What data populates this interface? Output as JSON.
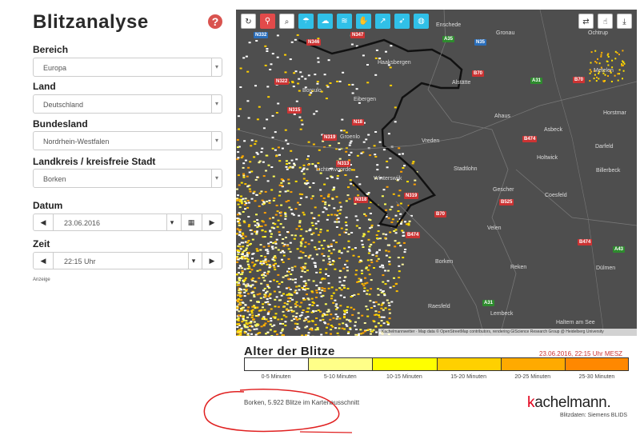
{
  "page_title": "Blitzanalyse",
  "help_icon": "?",
  "filters": {
    "bereich_label": "Bereich",
    "bereich_value": "Europa",
    "land_label": "Land",
    "land_value": "Deutschland",
    "bundesland_label": "Bundesland",
    "bundesland_value": "Nordrhein-Westfalen",
    "landkreis_label": "Landkreis / kreisfreie Stadt",
    "landkreis_value": "Borken",
    "datum_label": "Datum",
    "datum_value": "23.06.2016",
    "zeit_label": "Zeit",
    "zeit_value": "22:15 Uhr"
  },
  "ad_label": "Anzeige",
  "map": {
    "left_toolbar_icons": [
      "refresh-icon",
      "location-pin-icon",
      "zoom-icon",
      "umbrella-icon",
      "cloud-icon",
      "wind-icon",
      "hand-icon",
      "arrow-icon",
      "wind-arrow-icon",
      "globe-icon"
    ],
    "right_toolbar_icons": [
      "animation-icon",
      "like-icon",
      "download-icon"
    ],
    "roads": [
      "N332",
      "N346",
      "N347",
      "A35",
      "N35",
      "B70",
      "A31",
      "N322",
      "N315",
      "N18",
      "N319",
      "N313",
      "B474",
      "N318",
      "N319",
      "B70",
      "B525",
      "B474",
      "A43",
      "A31",
      "B70",
      "B474"
    ],
    "towns": [
      "Enschede",
      "Gronau",
      "Ochtrup",
      "Haaksbergen",
      "Metelen",
      "Alstätte",
      "Borculo",
      "Eibergen",
      "Horstmar",
      "Ahaus",
      "Asbeck",
      "Groenlo",
      "Vreden",
      "Holtwick",
      "Darfeld",
      "Stadtlohn",
      "Billerbeck",
      "Lichtenvoorde",
      "Winterswijk",
      "Gescher",
      "Coesfeld",
      "Velen",
      "Borken",
      "Reken",
      "Dülmen",
      "Raesfeld",
      "Lembeck",
      "Haltern am See"
    ],
    "attribution": "Kachelmannwetter · Map data © OpenStreetMap contributors, rendering GIScience Research Group @ Heidelberg University"
  },
  "legend": {
    "title": "Alter der Blitze",
    "timestamp": "23.06.2016, 22:15 Uhr MESZ",
    "bins": [
      {
        "label": "0-5 Minuten",
        "color": "#ffffff"
      },
      {
        "label": "5-10 Minuten",
        "color": "#ffff88"
      },
      {
        "label": "10-15 Minuten",
        "color": "#ffff00"
      },
      {
        "label": "15-20 Minuten",
        "color": "#ffd000"
      },
      {
        "label": "20-25 Minuten",
        "color": "#ffaa00"
      },
      {
        "label": "25-30 Minuten",
        "color": "#ff8800"
      }
    ]
  },
  "count_text": "Borken, 5.922 Blitze im Kartenausschnitt",
  "logo": {
    "first": "k",
    "rest": "achelmann."
  },
  "credit": "Blitzdaten: Siemens BLIDS"
}
